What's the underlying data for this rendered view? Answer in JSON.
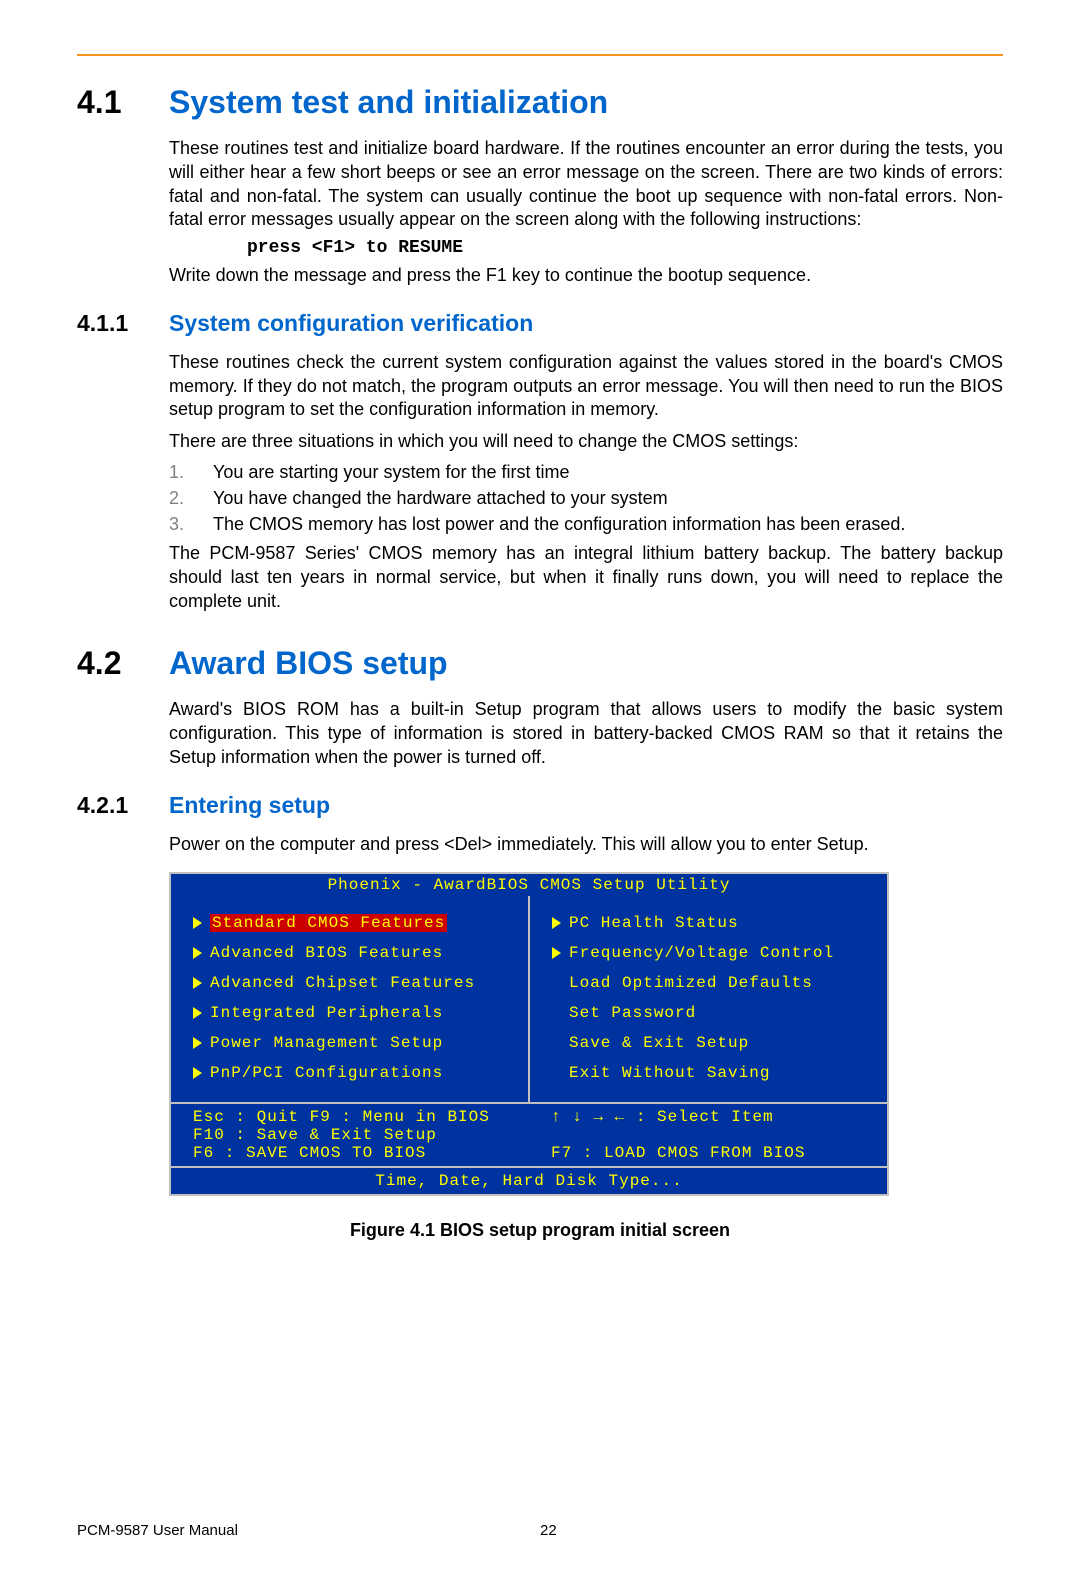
{
  "s41": {
    "num": "4.1",
    "title": "System test and initialization",
    "p1": "These routines test and initialize board hardware. If the routines encounter an error during the tests, you will either hear a few short beeps or see an error message on the screen. There are two kinds of errors: fatal and non-fatal. The system can usually continue the boot up sequence with non-fatal errors. Non-fatal error messages usually appear on the screen along with the following instructions:",
    "code": "press <F1> to RESUME",
    "p2": "Write down the message and press the F1 key to continue the bootup sequence."
  },
  "s411": {
    "num": "4.1.1",
    "title": "System configuration verification",
    "p1": "These routines check the current system configuration against the values stored in the board's CMOS memory. If they do not match, the program outputs an error message. You will then need to run the BIOS setup program to set the configuration information in memory.",
    "p2": "There are three situations in which you will need to change the CMOS settings:",
    "items": [
      {
        "n": "1.",
        "t": "You are starting your system for the first time"
      },
      {
        "n": "2.",
        "t": "You have changed the hardware attached to your system"
      },
      {
        "n": "3.",
        "t": "The CMOS memory has lost power and the configuration information has been erased."
      }
    ],
    "p3": "The PCM-9587 Series' CMOS memory has an integral lithium battery backup. The battery backup should last ten years in normal service, but when it finally runs down, you will need to replace the complete unit."
  },
  "s42": {
    "num": "4.2",
    "title": "Award BIOS setup",
    "p1": "Award's BIOS ROM has a built-in Setup program that allows users to modify the basic system configuration. This type of information is stored in battery-backed CMOS RAM so that it retains the Setup information when the power is turned off."
  },
  "s421": {
    "num": "4.2.1",
    "title": " Entering setup",
    "p1": "Power on the computer and press <Del> immediately. This will allow you to enter Setup."
  },
  "bios": {
    "title": "Phoenix - AwardBIOS CMOS Setup Utility",
    "left": {
      "i0": "Standard CMOS Features",
      "i1": "Advanced BIOS Features",
      "i2": "Advanced Chipset Features",
      "i3": "Integrated Peripherals",
      "i4": "Power Management Setup",
      "i5": "PnP/PCI Configurations"
    },
    "right": {
      "i0": "PC Health Status",
      "i1": "Frequency/Voltage Control",
      "i2": "Load Optimized Defaults",
      "i3": "Set Password",
      "i4": "Save & Exit Setup",
      "i5": "Exit Without Saving"
    },
    "footer": {
      "l1": "Esc : Quit     F9 : Menu in BIOS",
      "l2": "F10 : Save & Exit Setup",
      "l3": "F6  : SAVE CMOS TO BIOS",
      "r1": "↑ ↓ → ←   : Select Item",
      "r3": "F7  : LOAD CMOS FROM BIOS"
    },
    "status": "Time, Date, Hard Disk Type..."
  },
  "caption": "Figure 4.1 BIOS setup program initial screen",
  "footer": {
    "left": "PCM-9587 User Manual",
    "pagenum": "22"
  }
}
